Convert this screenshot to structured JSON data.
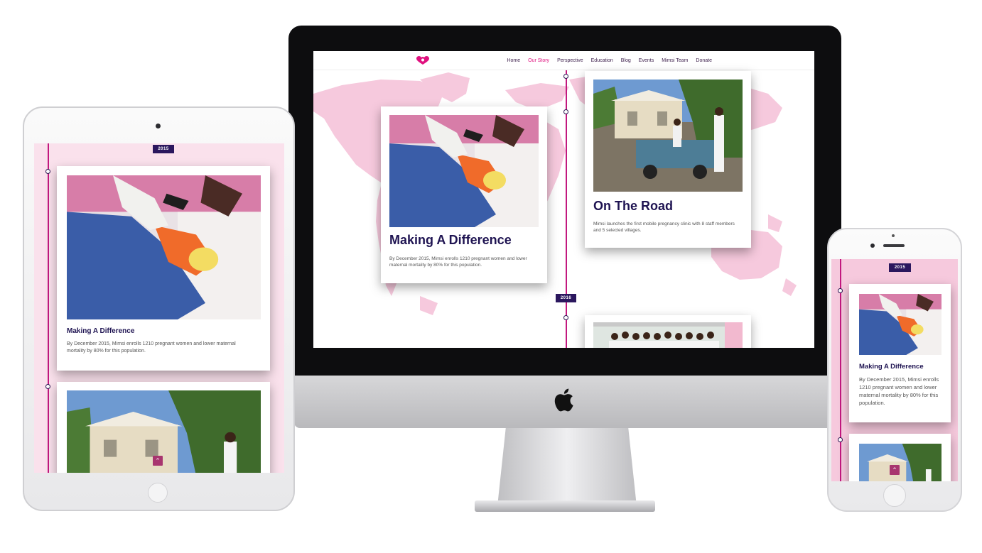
{
  "desktop": {
    "nav": {
      "logo_icon": "heart-logo-icon",
      "items": [
        "Home",
        "Our Story",
        "Perspective",
        "Education",
        "Blog",
        "Events",
        "Mimsi Team",
        "Donate"
      ],
      "active": "Our Story"
    },
    "card_left": {
      "title": "Making A Difference",
      "text": "By December 2015, Mimsi enrolls 1210 pregnant women and lower maternal mortality by 80% for this population."
    },
    "card_right": {
      "title": "On The Road",
      "text": "Mimsi launches the first mobile pregnancy clinic with 8 staff members and 5 selected villages."
    },
    "year_badge": "2016"
  },
  "tablet": {
    "year_badge": "2015",
    "card": {
      "title": "Making A Difference",
      "text": "By December 2015, Mimsi enrolls 1210 pregnant women and lower maternal mortality by 80% for this population."
    },
    "scroll_top_icon": "chevron-up-icon"
  },
  "phone": {
    "year_badge": "2015",
    "card": {
      "title": "Making A Difference",
      "text": "By December 2015, Mimsi enrolls 1210 pregnant women and lower maternal mortality by 80% for this population."
    },
    "scroll_top_icon": "chevron-up-icon"
  },
  "colors": {
    "accent": "#e0117f",
    "timeline": "#c2187e",
    "navy": "#2b175e",
    "map_pink": "#f6c9dd"
  }
}
